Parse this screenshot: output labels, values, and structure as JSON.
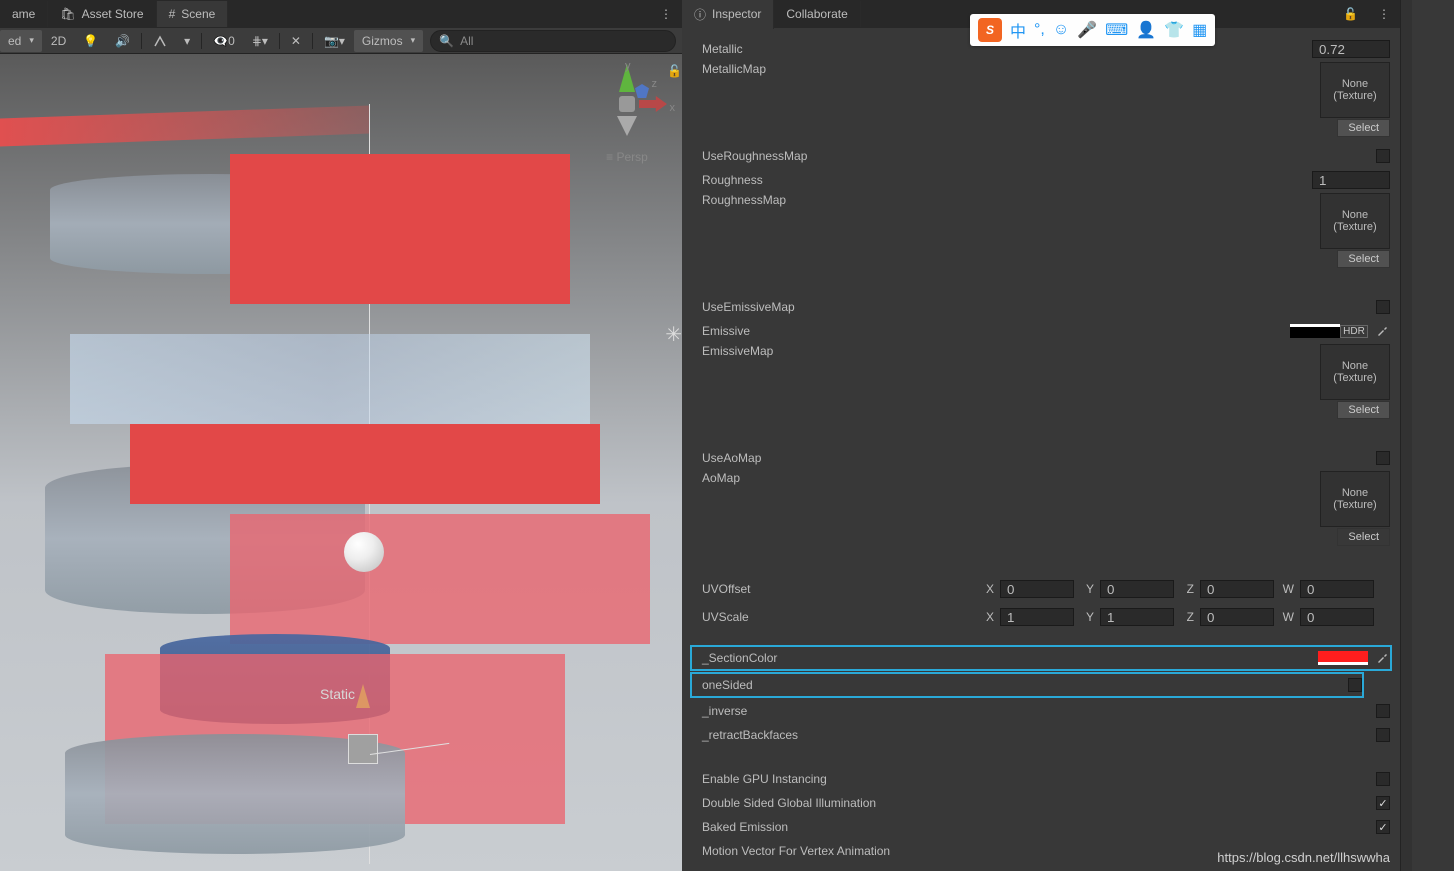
{
  "leftTabs": {
    "game": "ame",
    "assetStore": "Asset Store",
    "scene": "Scene"
  },
  "sceneToolbar": {
    "shaded": "ed",
    "mode2d": "2D",
    "hiddenCount": "0",
    "gizmos": "Gizmos",
    "searchPlaceholder": "All"
  },
  "sceneOverlay": {
    "persp": "Persp",
    "static": "Static",
    "axisY": "y",
    "axisX": "x",
    "axisZ": "z"
  },
  "rightTabs": {
    "inspector": "Inspector",
    "collaborate": "Collaborate"
  },
  "ime": {
    "logo": "S",
    "zhong": "中",
    "items": [
      "°,",
      "☺",
      "⌨",
      "👤",
      "👕",
      "▦"
    ]
  },
  "inspector": {
    "metallic": {
      "label": "Metallic",
      "value": "0.72"
    },
    "metallicMap": "MetallicMap",
    "useRoughnessMap": "UseRoughnessMap",
    "roughness": {
      "label": "Roughness",
      "value": "1"
    },
    "roughnessMap": "RoughnessMap",
    "useEmissiveMap": "UseEmissiveMap",
    "emissive": "Emissive",
    "emissiveMap": "EmissiveMap",
    "hdr": "HDR",
    "useAoMap": "UseAoMap",
    "aoMap": "AoMap",
    "noneTexture1": "None",
    "noneTexture2": "(Texture)",
    "selectBtn": "Select",
    "uvOffset": {
      "label": "UVOffset",
      "x": "0",
      "y": "0",
      "z": "0",
      "w": "0"
    },
    "uvScale": {
      "label": "UVScale",
      "x": "1",
      "y": "1",
      "z": "0",
      "w": "0"
    },
    "axisLabels": {
      "x": "X",
      "y": "Y",
      "z": "Z",
      "w": "W"
    },
    "sectionColor": {
      "label": "_SectionColor",
      "color": "#ff1e1e"
    },
    "oneSided": "oneSided",
    "inverse": "_inverse",
    "retractBackfaces": "_retractBackfaces",
    "gpuInstancing": "Enable GPU Instancing",
    "doubleSided": "Double Sided Global Illumination",
    "bakedEmission": "Baked Emission",
    "motionVector": "Motion Vector For Vertex Animation"
  },
  "watermark": "https://blog.csdn.net/llhswwha"
}
